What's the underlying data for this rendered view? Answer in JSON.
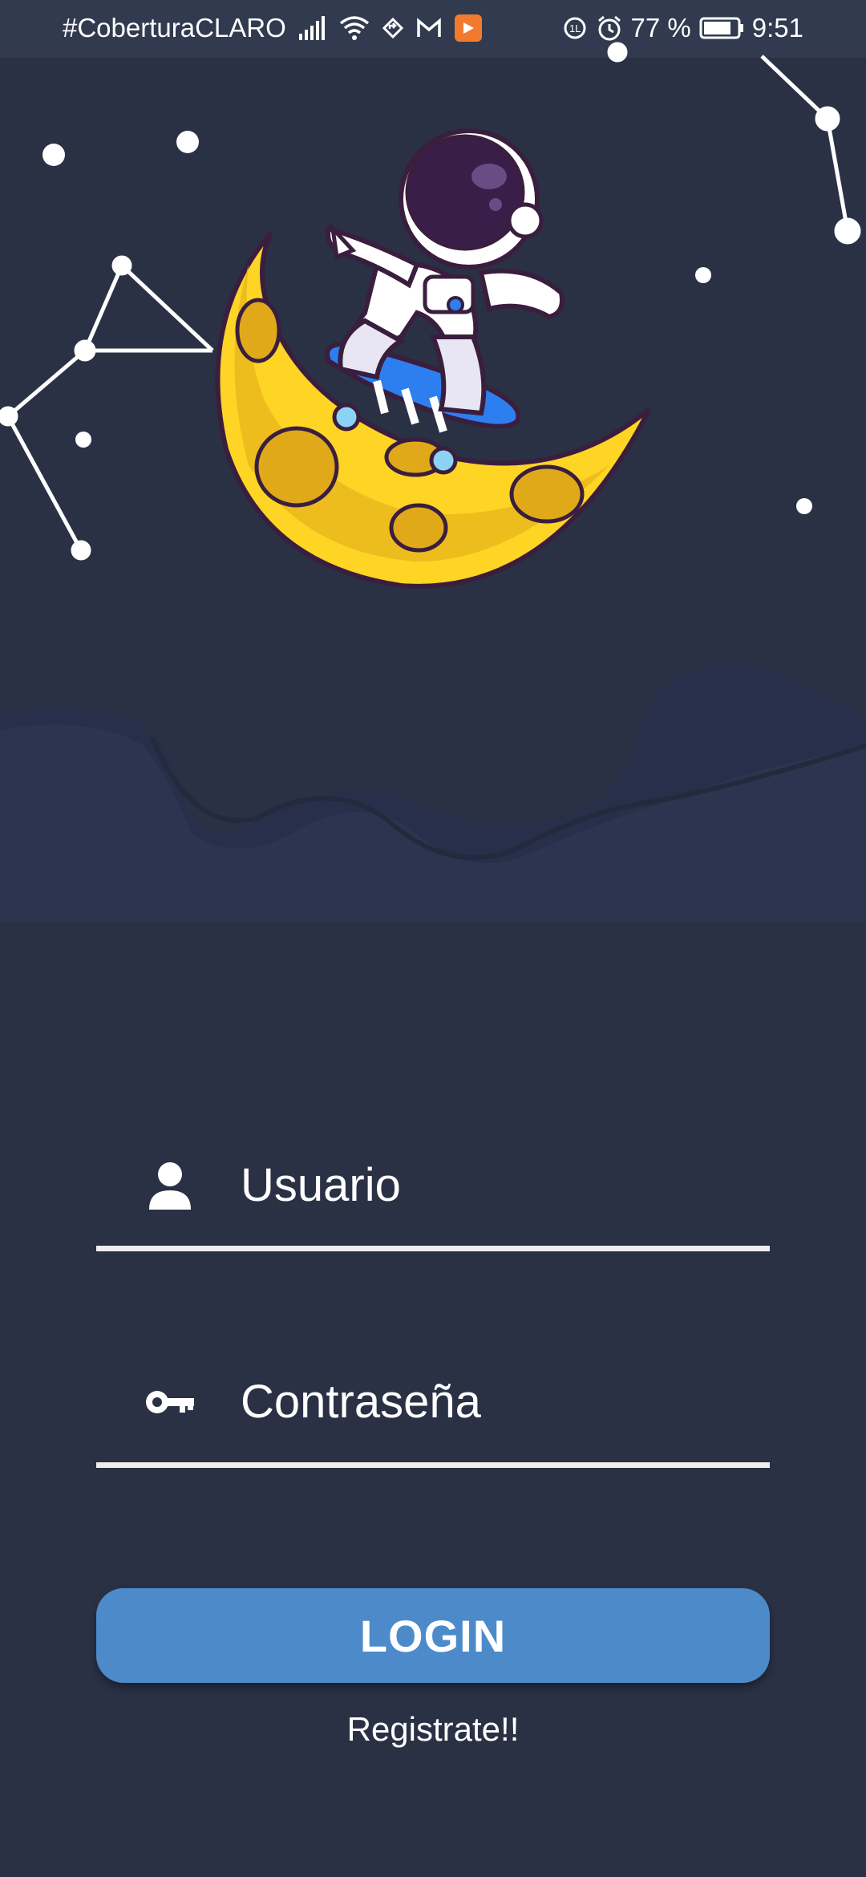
{
  "status_bar": {
    "carrier": "#CoberturaCLARO",
    "battery_percent": "77 %",
    "time": "9:51"
  },
  "login_form": {
    "username_placeholder": "Usuario",
    "password_placeholder": "Contraseña",
    "login_label": "LOGIN",
    "register_label": "Registrate!!"
  },
  "colors": {
    "background": "#2a3145",
    "button": "#4d8ac9",
    "moon": "#fed425"
  },
  "icons": {
    "user": "user-icon",
    "key": "key-icon"
  }
}
